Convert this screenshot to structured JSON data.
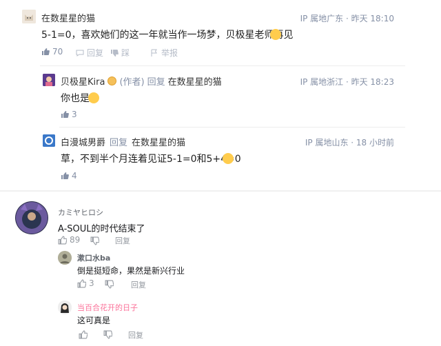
{
  "c1": {
    "user": "在数星星的猫",
    "ip": "IP 属地广东 · 昨天 18:10",
    "text": "5-1=0，喜欢她们的这一年就当作一场梦，贝极星老师再见",
    "likes": "70",
    "reply_label": "回复",
    "dislike_label": "踩",
    "report_label": "举报"
  },
  "c2": {
    "user": "贝极星Kira",
    "author_tag": "(作者)",
    "reply_label": "回复",
    "reply_to": "在数星星的猫",
    "ip": "IP 属地浙江 · 昨天 18:23",
    "text": "你也是",
    "likes": "3"
  },
  "c3": {
    "user": "白漫城男爵",
    "reply_label": "回复",
    "reply_to": "在数星星的猫",
    "ip": "IP 属地山东 · 18 小时前",
    "text": "草，不到半个月连着见证5-1=0和5+4=0",
    "likes": "4"
  },
  "b1": {
    "user": "カミヤヒロシ",
    "text": "A-SOUL的时代结束了",
    "likes": "89",
    "reply_label": "回复"
  },
  "b2": {
    "user": "漱口水ba",
    "text": "倒是挺短命，果然是新兴行业",
    "likes": "3",
    "reply_label": "回复"
  },
  "b3": {
    "user": "当百合花开的日子",
    "text": "这可真是",
    "reply_label": "回复"
  },
  "colors": {
    "meta": "#8590a6",
    "pink_name": "#fb7299",
    "text": "#222222"
  }
}
